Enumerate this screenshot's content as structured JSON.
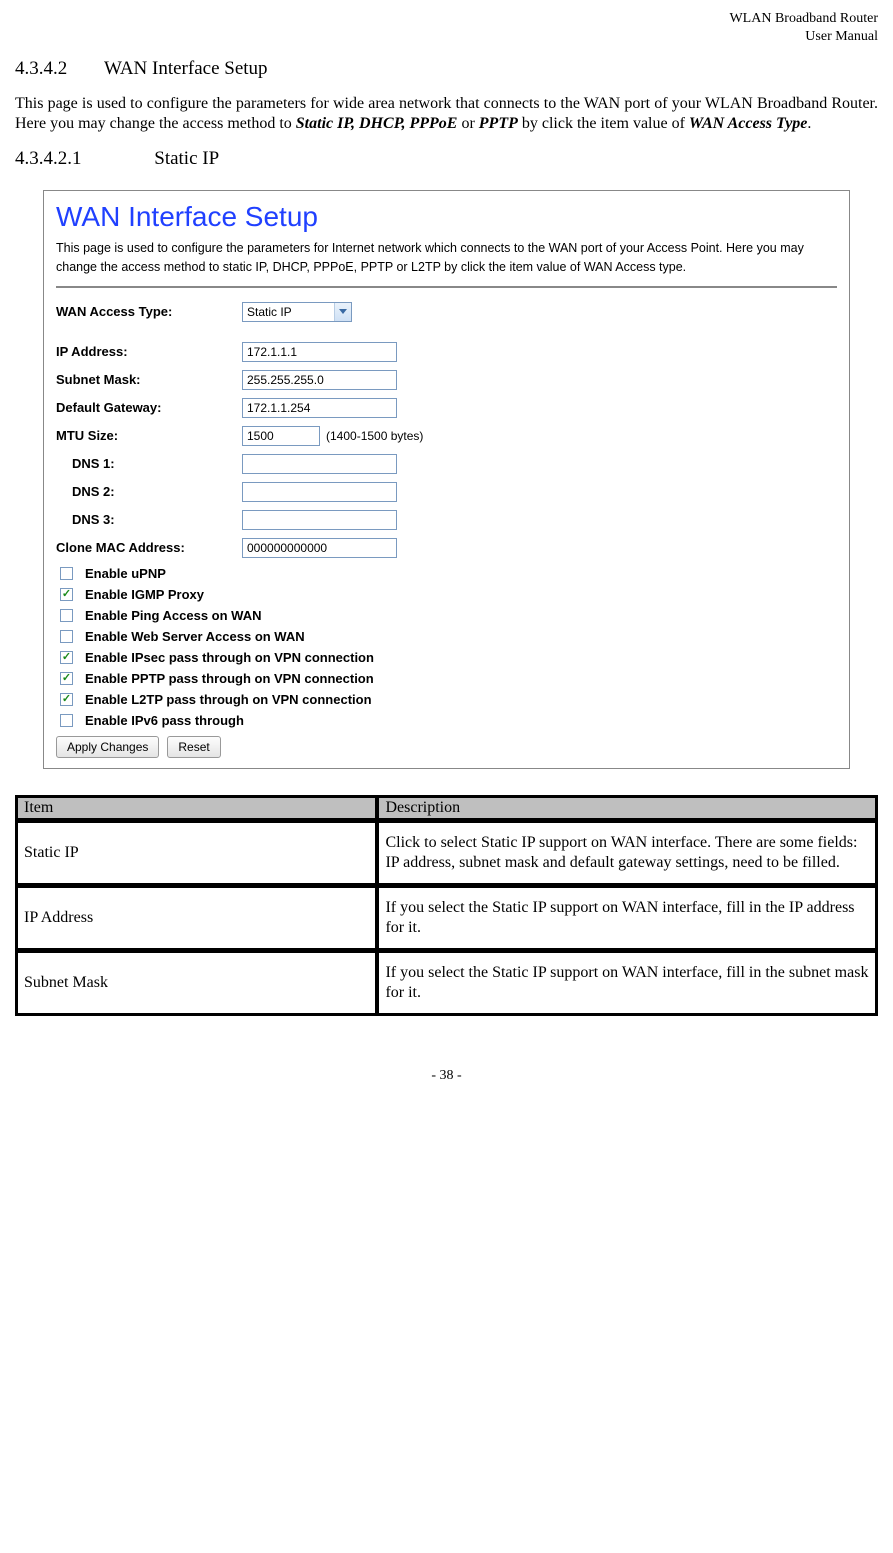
{
  "header": {
    "line1": "WLAN  Broadband  Router",
    "line2": "User  Manual"
  },
  "section": {
    "num": "4.3.4.2",
    "title": "WAN Interface Setup"
  },
  "intro": {
    "part1": "This page is used to configure the parameters for wide area network that connects to the WAN port of your WLAN Broadband Router. Here you may change the access method to ",
    "bi1": "Static IP, DHCP, PPPoE",
    "part2": " or ",
    "bi2": "PPTP",
    "part3": " by click the item value of ",
    "bi3": "WAN Access Type",
    "part4": "."
  },
  "subsection": {
    "num": "4.3.4.2.1",
    "title": "Static IP"
  },
  "screenshot": {
    "title": "WAN Interface Setup",
    "desc": "This page is used to configure the parameters for Internet network which connects to the WAN port of your Access Point. Here you may change the access method to static IP, DHCP, PPPoE, PPTP or L2TP by click the item value of WAN Access type.",
    "fields": {
      "wan_access_type": {
        "label": "WAN Access Type:",
        "value": "Static IP"
      },
      "ip_address": {
        "label": "IP Address:",
        "value": "172.1.1.1"
      },
      "subnet_mask": {
        "label": "Subnet Mask:",
        "value": "255.255.255.0"
      },
      "default_gateway": {
        "label": "Default Gateway:",
        "value": "172.1.1.254"
      },
      "mtu_size": {
        "label": "MTU Size:",
        "value": "1500",
        "hint": "(1400-1500 bytes)"
      },
      "dns1": {
        "label": "DNS 1:",
        "value": ""
      },
      "dns2": {
        "label": "DNS 2:",
        "value": ""
      },
      "dns3": {
        "label": "DNS 3:",
        "value": ""
      },
      "clone_mac": {
        "label": "Clone MAC Address:",
        "value": "000000000000"
      }
    },
    "checkboxes": [
      {
        "label": "Enable uPNP",
        "checked": false
      },
      {
        "label": "Enable IGMP Proxy",
        "checked": true
      },
      {
        "label": "Enable Ping Access on WAN",
        "checked": false
      },
      {
        "label": "Enable Web Server Access on WAN",
        "checked": false
      },
      {
        "label": "Enable IPsec pass through on VPN connection",
        "checked": true
      },
      {
        "label": "Enable PPTP pass through on VPN connection",
        "checked": true
      },
      {
        "label": "Enable L2TP pass through on VPN connection",
        "checked": true
      },
      {
        "label": "Enable IPv6 pass through",
        "checked": false
      }
    ],
    "buttons": {
      "apply": "Apply Changes",
      "reset": "Reset"
    }
  },
  "table": {
    "head_item": "Item",
    "head_desc": "Description",
    "rows": [
      {
        "item": "Static IP",
        "desc": "Click to select Static IP support on WAN interface. There are some fields: IP address, subnet mask and default gateway settings, need to be filled."
      },
      {
        "item": "IP Address",
        "desc": "If you select the Static IP support on WAN interface, fill in the IP address for it."
      },
      {
        "item": "Subnet Mask",
        "desc": "If you select the Static IP support on WAN interface, fill in the subnet mask for it."
      }
    ]
  },
  "footer": "- 38 -"
}
